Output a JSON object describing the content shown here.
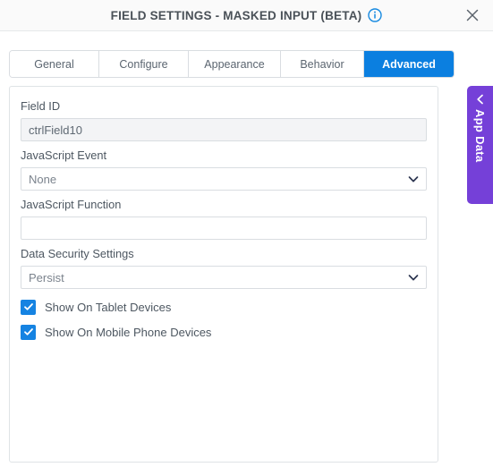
{
  "titlebar": {
    "title": "FIELD SETTINGS - MASKED INPUT (BETA)",
    "info_icon": "info-circle-icon",
    "close_icon": "close-icon"
  },
  "tabs": [
    {
      "label": "General",
      "active": false
    },
    {
      "label": "Configure",
      "active": false
    },
    {
      "label": "Appearance",
      "active": false
    },
    {
      "label": "Behavior",
      "active": false
    },
    {
      "label": "Advanced",
      "active": true
    }
  ],
  "form": {
    "field_id": {
      "label": "Field ID",
      "value": "ctrlField10",
      "readonly": true
    },
    "javascript_event": {
      "label": "JavaScript Event",
      "value": "None",
      "caret_icon": "chevron-down-icon"
    },
    "javascript_function": {
      "label": "JavaScript Function",
      "value": "",
      "placeholder": ""
    },
    "data_security_settings": {
      "label": "Data Security Settings",
      "value": "Persist",
      "caret_icon": "chevron-down-icon"
    },
    "checkboxes": [
      {
        "label": "Show On Tablet Devices",
        "checked": true
      },
      {
        "label": "Show On Mobile Phone Devices",
        "checked": true
      }
    ]
  },
  "side_panel": {
    "label": "App Data",
    "collapse_icon": "chevron-left-icon"
  },
  "colors": {
    "accent_blue": "#0b7fe0",
    "checkbox_blue": "#1583e2",
    "app_data_purple": "#7540d8",
    "title_text": "#4a5158",
    "label_text": "#4d5761",
    "border": "#d9dde1"
  }
}
